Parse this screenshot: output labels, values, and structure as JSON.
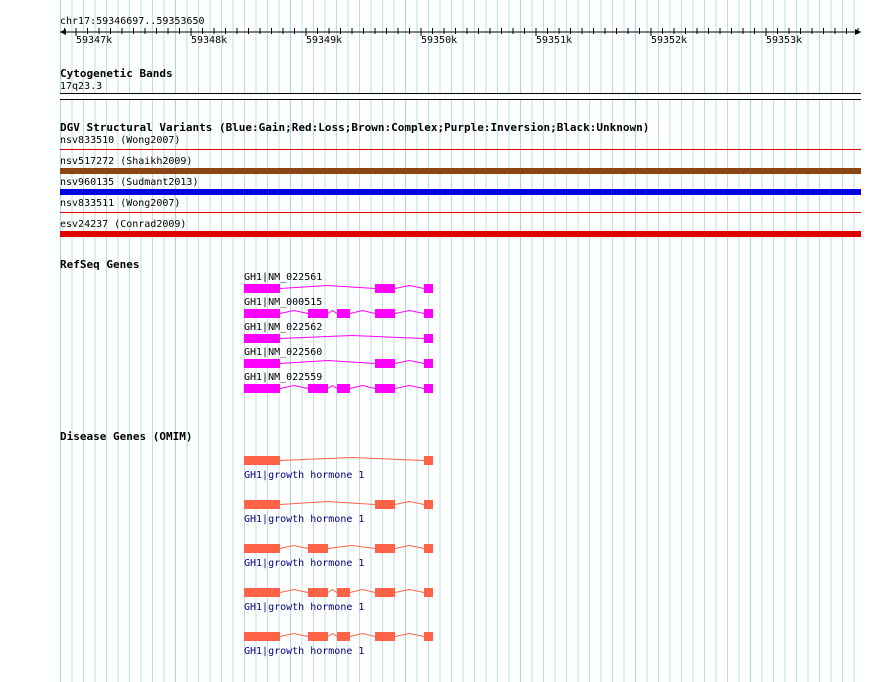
{
  "ruler": {
    "coords": "chr17:59346697..59353650",
    "ticks": [
      "59347k",
      "59348k",
      "59349k",
      "59350k",
      "59351k",
      "59352k",
      "59353k"
    ]
  },
  "tracks": {
    "cytoband": {
      "title": "Cytogenetic Bands",
      "band": "17q23.3"
    },
    "dgv": {
      "title": "DGV Structural Variants (Blue:Gain;Red:Loss;Brown:Complex;Purple:Inversion;Black:Unknown)",
      "variants": [
        {
          "label": "nsv833510 (Wong2007)",
          "color": "#e00000"
        },
        {
          "label": "nsv517272 (Shaikh2009)",
          "color": "#8b4513"
        },
        {
          "label": "nsv960135 (Sudmant2013)",
          "color": "#0000e0"
        },
        {
          "label": "nsv833511 (Wong2007)",
          "color": "#e00000"
        },
        {
          "label": "esv24237 (Conrad2009)",
          "color": "#e00000"
        }
      ]
    },
    "refseq": {
      "title": "RefSeq Genes",
      "color": "#ff00ff",
      "genes": [
        {
          "label": "GH1|NM_022561"
        },
        {
          "label": "GH1|NM_000515"
        },
        {
          "label": "GH1|NM_022562"
        },
        {
          "label": "GH1|NM_022560"
        },
        {
          "label": "GH1|NM_022559"
        }
      ]
    },
    "omim": {
      "title": "Disease Genes (OMIM)",
      "color": "#ff6347",
      "genes": [
        {
          "label": "GH1|growth hormone 1"
        },
        {
          "label": "GH1|growth hormone 1"
        },
        {
          "label": "GH1|growth hormone 1"
        },
        {
          "label": "GH1|growth hormone 1"
        },
        {
          "label": "GH1|growth hormone 1"
        }
      ]
    }
  },
  "colors": {
    "grid_line": "#a8d8e4",
    "omim_label": "#000080"
  }
}
